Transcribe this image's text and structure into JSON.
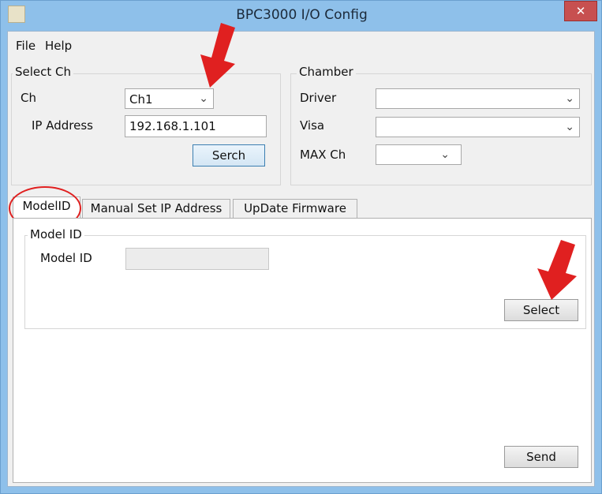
{
  "window": {
    "title": "BPC3000 I/O Config",
    "close_glyph": "✕"
  },
  "menu": {
    "file": "File",
    "help": "Help"
  },
  "select_ch": {
    "legend": "Select Ch",
    "ch_label": "Ch",
    "ch_value": "Ch1",
    "ip_label": "IP Address",
    "ip_value": "192.168.1.101",
    "search_button": "Serch"
  },
  "chamber": {
    "legend": "Chamber",
    "driver_label": "Driver",
    "driver_value": "",
    "visa_label": "Visa",
    "visa_value": "",
    "maxch_label": "MAX Ch",
    "maxch_value": ""
  },
  "tabs": [
    {
      "label": "ModelID"
    },
    {
      "label": "Manual Set IP Address"
    },
    {
      "label": "UpDate Firmware"
    }
  ],
  "model_panel": {
    "legend": "Model ID",
    "label": "Model ID",
    "value": "",
    "select_button": "Select"
  },
  "send_button": "Send",
  "chevron": "⌄",
  "colors": {
    "accent_red": "#e02020",
    "title_bar": "#8ec0ea",
    "close_button": "#c75050"
  }
}
